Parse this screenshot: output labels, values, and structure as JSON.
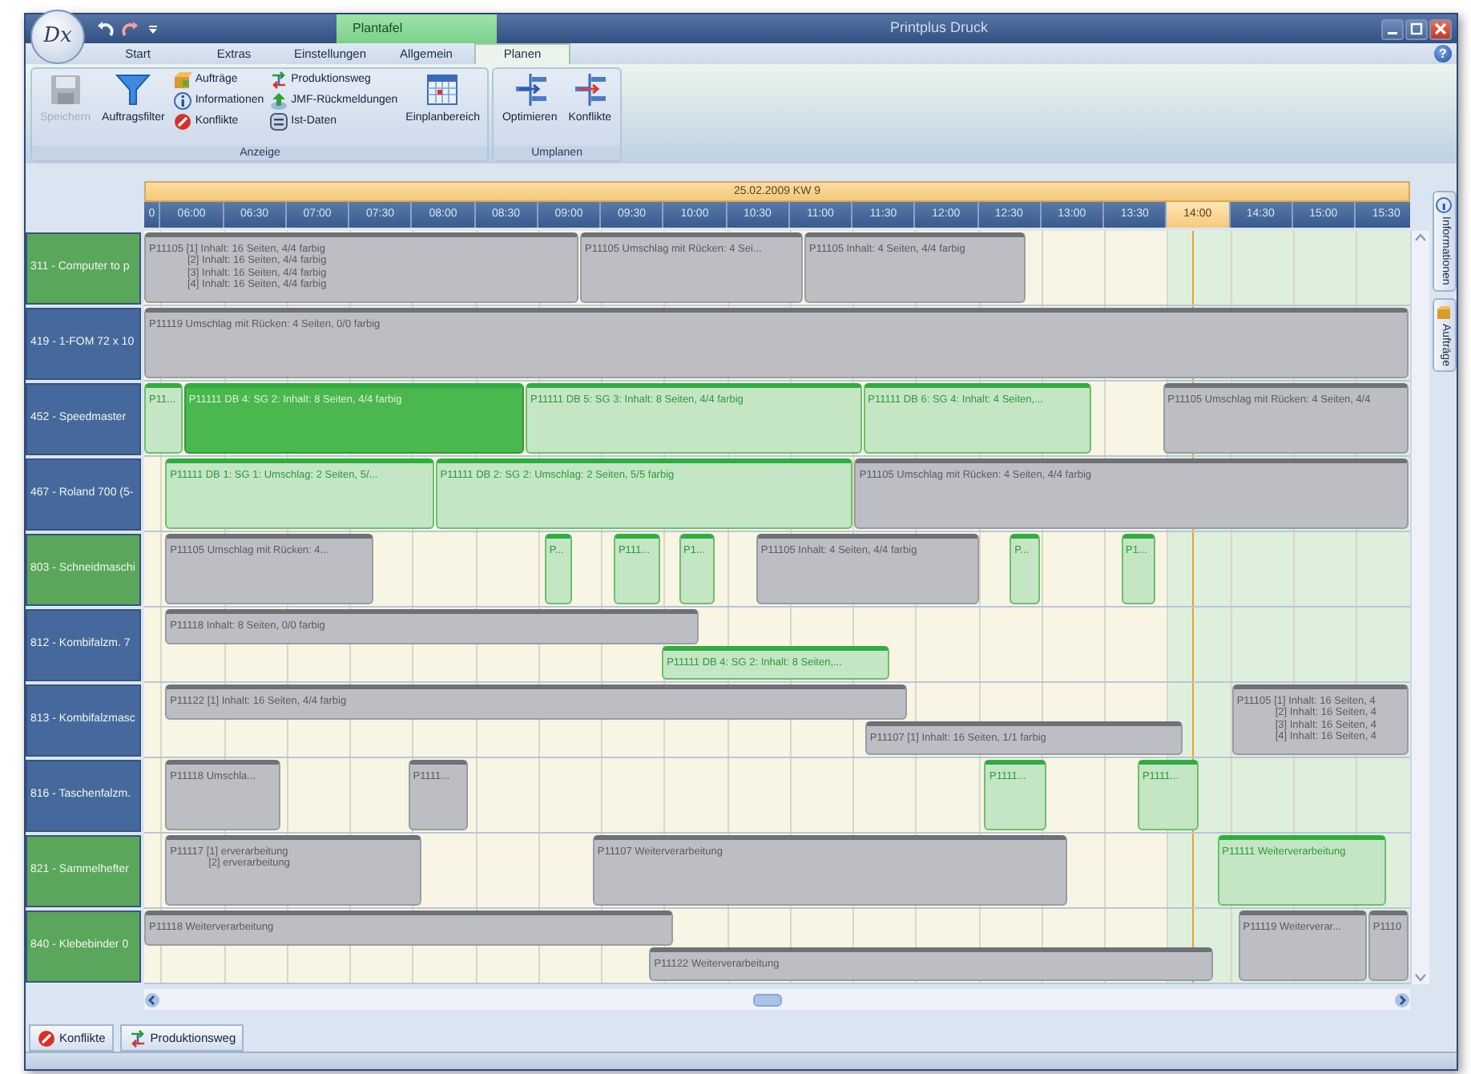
{
  "window": {
    "logo": "Dx",
    "context_tab": "Plantafel",
    "title": "Printplus Druck",
    "help": "?"
  },
  "ribbon": {
    "tabs": [
      {
        "label": "Start",
        "selected": false
      },
      {
        "label": "Extras",
        "selected": false
      },
      {
        "label": "Einstellungen",
        "selected": false
      },
      {
        "label": "Allgemein",
        "selected": false
      },
      {
        "label": "Planen",
        "selected": true
      }
    ],
    "groups": [
      {
        "label": "Anzeige",
        "items": [
          {
            "kind": "large",
            "label": "Speichern",
            "disabled": true
          },
          {
            "kind": "large",
            "label": "Auftragsfilter",
            "disabled": false
          },
          {
            "kind": "column",
            "entries": [
              "Aufträge",
              "Informationen",
              "Konflikte"
            ]
          },
          {
            "kind": "column",
            "entries": [
              "Produktionsweg",
              "JMF-Rückmeldungen",
              "Ist-Daten"
            ]
          },
          {
            "kind": "large",
            "label": "Einplanbereich",
            "disabled": false
          }
        ]
      },
      {
        "label": "Umplanen",
        "items": [
          {
            "kind": "large",
            "label": "Optimieren",
            "disabled": false
          },
          {
            "kind": "large",
            "label": "Konflikte",
            "disabled": false
          }
        ]
      }
    ]
  },
  "timeline": {
    "date": "25.02.2009  KW 9",
    "ticks": [
      {
        "label": "0",
        "selected": false
      },
      {
        "label": "06:00",
        "selected": false
      },
      {
        "label": "06:30",
        "selected": false
      },
      {
        "label": "07:00",
        "selected": false
      },
      {
        "label": "07:30",
        "selected": false
      },
      {
        "label": "08:00",
        "selected": false
      },
      {
        "label": "08:30",
        "selected": false
      },
      {
        "label": "09:00",
        "selected": false
      },
      {
        "label": "09:30",
        "selected": false
      },
      {
        "label": "10:00",
        "selected": false
      },
      {
        "label": "10:30",
        "selected": false
      },
      {
        "label": "11:00",
        "selected": false
      },
      {
        "label": "11:30",
        "selected": false
      },
      {
        "label": "12:00",
        "selected": false
      },
      {
        "label": "12:30",
        "selected": false
      },
      {
        "label": "13:00",
        "selected": false
      },
      {
        "label": "13:30",
        "selected": false
      },
      {
        "label": "14:00",
        "selected": true
      },
      {
        "label": "14:30",
        "selected": false
      },
      {
        "label": "15:00",
        "selected": false
      },
      {
        "label": "15:30",
        "selected": false
      }
    ]
  },
  "rows": [
    {
      "label": "311 - Computer to p",
      "color": "#5aa65a",
      "jobs": [
        {
          "kind": "planned",
          "lines": [
            "P11105  [1] Inhalt: 16 Seiten, 4/4 farbig",
            "[2] Inhalt: 16 Seiten, 4/4 farbig",
            "[3] Inhalt: 16 Seiten, 4/4 farbig",
            "[4] Inhalt: 16 Seiten, 4/4 farbig"
          ]
        },
        {
          "kind": "planned",
          "lines": [
            "P11105  Umschlag mit Rücken: 4 Sei..."
          ]
        },
        {
          "kind": "planned",
          "lines": [
            "P11105  Inhalt: 4 Seiten, 4/4 farbig"
          ]
        }
      ]
    },
    {
      "label": "419 - 1-FOM 72 x 10",
      "color": "#45699c",
      "jobs": [
        {
          "kind": "planned",
          "lines": [
            "P11119  Umschlag mit Rücken: 4 Seiten, 0/0 farbig"
          ]
        }
      ]
    },
    {
      "label": "452 - Speedmaster",
      "color": "#45699c",
      "jobs": [
        {
          "kind": "active",
          "lines": [
            "P11..."
          ]
        },
        {
          "kind": "current",
          "lines": [
            "P11111  DB 4: SG 2: Inhalt: 8 Seiten, 4/4 farbig"
          ]
        },
        {
          "kind": "active",
          "lines": [
            "P11111  DB 5: SG 3: Inhalt: 8 Seiten, 4/4 farbig"
          ]
        },
        {
          "kind": "active",
          "lines": [
            "P11111  DB 6: SG 4: Inhalt: 4 Seiten,..."
          ]
        },
        {
          "kind": "planned",
          "lines": [
            "P11105  Umschlag mit Rücken: 4 Seiten, 4/4"
          ]
        }
      ]
    },
    {
      "label": "467 - Roland 700 (5-",
      "color": "#45699c",
      "jobs": [
        {
          "kind": "active",
          "lines": [
            "P11111  DB 1: SG 1: Umschlag: 2 Seiten, 5/..."
          ]
        },
        {
          "kind": "active",
          "lines": [
            "P11111  DB 2: SG 2: Umschlag: 2 Seiten, 5/5 farbig"
          ]
        },
        {
          "kind": "planned",
          "lines": [
            "P11105  Umschlag mit Rücken: 4 Seiten, 4/4 farbig"
          ]
        }
      ]
    },
    {
      "label": "803 - Schneidmaschi",
      "color": "#5aa65a",
      "jobs": [
        {
          "kind": "planned",
          "lines": [
            "P11105  Umschlag mit Rücken: 4..."
          ]
        },
        {
          "kind": "active",
          "lines": [
            "P..."
          ]
        },
        {
          "kind": "active",
          "lines": [
            "P111..."
          ]
        },
        {
          "kind": "active",
          "lines": [
            "P1..."
          ]
        },
        {
          "kind": "planned",
          "lines": [
            "P11105  Inhalt: 4 Seiten, 4/4 farbig"
          ]
        },
        {
          "kind": "active",
          "lines": [
            "P..."
          ]
        },
        {
          "kind": "active",
          "lines": [
            "P1..."
          ]
        }
      ]
    },
    {
      "label": "812 - Kombifalzm. 7",
      "color": "#45699c",
      "jobs": [
        {
          "kind": "planned",
          "lines": [
            "P11118  Inhalt: 8 Seiten, 0/0 farbig"
          ]
        },
        {
          "kind": "active",
          "lines": [
            "P11111  DB 4: SG 2: Inhalt: 8 Seiten,..."
          ]
        }
      ]
    },
    {
      "label": "813 - Kombifalzmasc",
      "color": "#45699c",
      "jobs": [
        {
          "kind": "planned",
          "lines": [
            "P11122  [1] Inhalt: 16 Seiten, 4/4 farbig"
          ]
        },
        {
          "kind": "planned",
          "lines": [
            "P11107  [1] Inhalt: 16 Seiten, 1/1 farbig"
          ]
        },
        {
          "kind": "planned",
          "lines": [
            "P11105  [1] Inhalt: 16 Seiten, 4",
            "[2] Inhalt: 16 Seiten, 4",
            "[3] Inhalt: 16 Seiten, 4",
            "[4] Inhalt: 16 Seiten, 4"
          ]
        }
      ]
    },
    {
      "label": "816 - Taschenfalzm.",
      "color": "#45699c",
      "jobs": [
        {
          "kind": "planned",
          "lines": [
            "P11118  Umschla..."
          ]
        },
        {
          "kind": "planned",
          "lines": [
            "P1111..."
          ]
        },
        {
          "kind": "active",
          "lines": [
            "P1111..."
          ]
        },
        {
          "kind": "active",
          "lines": [
            "P1111..."
          ]
        }
      ]
    },
    {
      "label": "821 - Sammelhefter",
      "color": "#5aa65a",
      "jobs": [
        {
          "kind": "planned",
          "lines": [
            "P11117  [1] erverarbeitung",
            "[2] erverarbeitung"
          ]
        },
        {
          "kind": "planned",
          "lines": [
            "P11107  Weiterverarbeitung"
          ]
        },
        {
          "kind": "active",
          "lines": [
            "P11111  Weiterverarbeitung"
          ]
        }
      ]
    },
    {
      "label": "840 - Klebebinder 0",
      "color": "#5aa65a",
      "jobs": [
        {
          "kind": "planned",
          "lines": [
            "P11118  Weiterverarbeitung"
          ]
        },
        {
          "kind": "planned",
          "lines": [
            "P11122  Weiterverarbeitung"
          ]
        },
        {
          "kind": "planned",
          "lines": [
            "P11119  Weiterverar..."
          ]
        },
        {
          "kind": "planned",
          "lines": [
            "P1110"
          ]
        }
      ]
    }
  ],
  "side_tabs": [
    {
      "label": "Informationen"
    },
    {
      "label": "Aufträge"
    }
  ],
  "bottom_tabs": [
    {
      "label": "Konflikte"
    },
    {
      "label": "Produktionsweg"
    }
  ]
}
